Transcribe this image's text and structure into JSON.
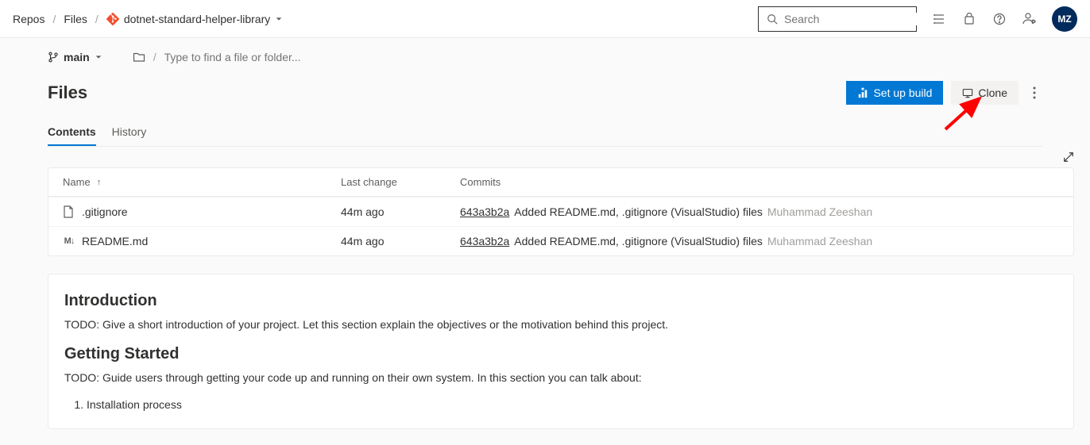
{
  "breadcrumb": {
    "item1": "Repos",
    "item2": "Files",
    "repo_name": "dotnet-standard-helper-library"
  },
  "search": {
    "placeholder": "Search"
  },
  "avatar": {
    "initials": "MZ"
  },
  "branch": {
    "name": "main"
  },
  "path_input": {
    "placeholder": "Type to find a file or folder..."
  },
  "page": {
    "title": "Files"
  },
  "buttons": {
    "setup_build": "Set up build",
    "clone": "Clone"
  },
  "tabs": {
    "contents": "Contents",
    "history": "History"
  },
  "table": {
    "headers": {
      "name": "Name",
      "last_change": "Last change",
      "commits": "Commits"
    },
    "rows": [
      {
        "icon": "file-icon",
        "name": ".gitignore",
        "last_change": "44m ago",
        "hash": "643a3b2a",
        "msg": "Added README.md, .gitignore (VisualStudio) files",
        "author": "Muhammad Zeeshan"
      },
      {
        "icon": "markdown-icon",
        "name": "README.md",
        "last_change": "44m ago",
        "hash": "643a3b2a",
        "msg": "Added README.md, .gitignore (VisualStudio) files",
        "author": "Muhammad Zeeshan"
      }
    ]
  },
  "readme": {
    "h1": "Introduction",
    "p1": "TODO: Give a short introduction of your project. Let this section explain the objectives or the motivation behind this project.",
    "h2": "Getting Started",
    "p2": "TODO: Guide users through getting your code up and running on their own system. In this section you can talk about:",
    "li1": "Installation process"
  }
}
